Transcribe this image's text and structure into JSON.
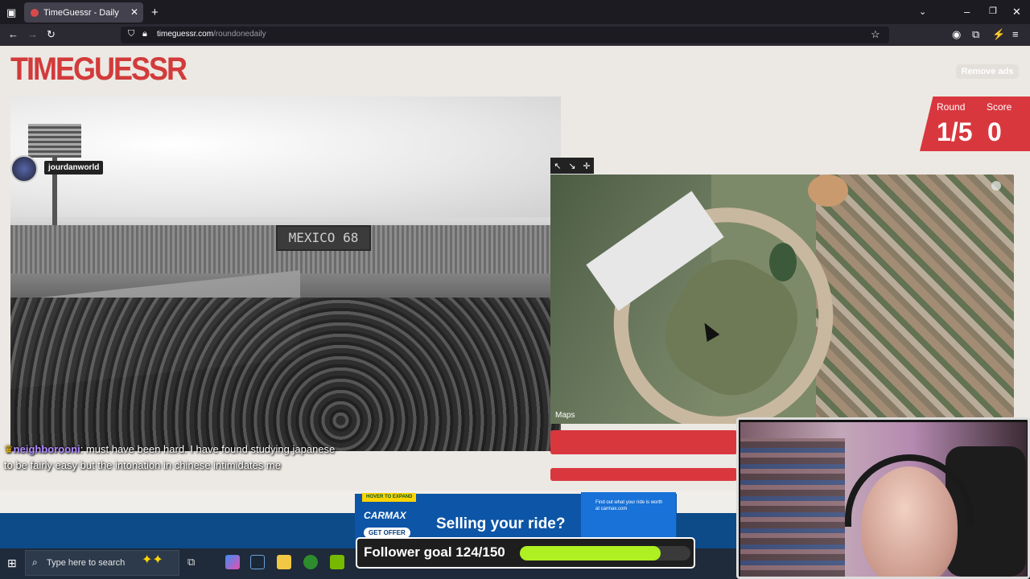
{
  "browser": {
    "tab_title": "TimeGuessr - Daily",
    "new_tab": "+",
    "url_domain": "timeguessr.com",
    "url_path": "/roundonedaily"
  },
  "site": {
    "logo": "TIMEGUESSR",
    "remove_ads": "Remove ads",
    "round_label": "Round",
    "round_value": "1/5",
    "score_label": "Score",
    "score_value": "0"
  },
  "photo": {
    "scoreboard_text": "MEXICO 68"
  },
  "stream": {
    "avatar_name": "jourdanworld",
    "chat_user": "neighborooni",
    "chat_message": ": must have been hard. I have found studying japanese to be fairly easy but the intonation in chinese intimidates me"
  },
  "map": {
    "watermark": "Maps",
    "tools": [
      "↖",
      "↘",
      "✛"
    ]
  },
  "ad": {
    "hover": "HOVER TO EXPAND",
    "brand": "CARMAX",
    "cta": "GET OFFER",
    "headline": "Selling your ride?",
    "side_text": "Find out what your ride is worth at carmax.com"
  },
  "goal": {
    "text": "Follower goal 124/150",
    "current": 124,
    "target": 150,
    "fill_color": "#aef021"
  },
  "taskbar": {
    "search_placeholder": "Type here to search"
  }
}
